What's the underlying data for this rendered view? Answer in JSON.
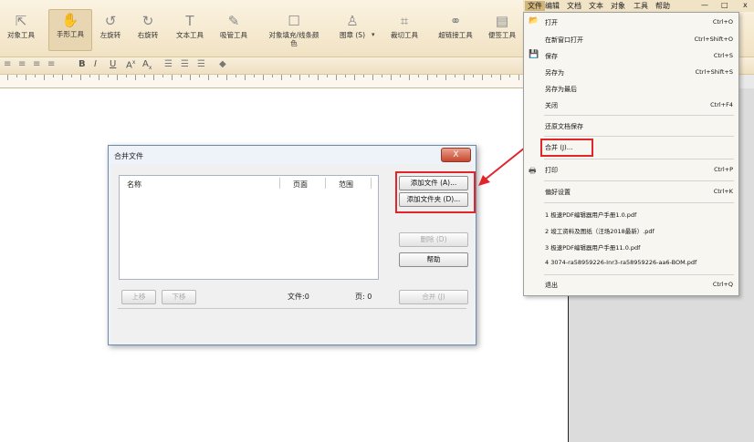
{
  "toolbar": {
    "tools": [
      {
        "label": "对象工具",
        "icon": "cursor-icon"
      },
      {
        "label": "手形工具",
        "icon": "hand-icon"
      },
      {
        "label": "左旋转",
        "icon": "rotate-left-icon"
      },
      {
        "label": "右旋转",
        "icon": "rotate-right-icon"
      },
      {
        "label": "文本工具",
        "icon": "text-icon"
      },
      {
        "label": "吸管工具",
        "icon": "eyedropper-icon"
      },
      {
        "label": "对象填充/线条颜",
        "label2": "色",
        "icon": "fill-icon"
      },
      {
        "label": "图章 (S)",
        "icon": "stamp-icon"
      },
      {
        "label": "裁切工具",
        "icon": "crop-icon"
      },
      {
        "label": "超链接工具",
        "icon": "link-icon"
      },
      {
        "label": "便签工具",
        "icon": "note-icon"
      }
    ]
  },
  "menubar": {
    "items": [
      "文件",
      "编辑",
      "文档",
      "文本",
      "对象",
      "工具",
      "帮助"
    ],
    "minimize": "—",
    "restore": "□",
    "close": "x"
  },
  "file_menu": {
    "items": [
      {
        "label": "打开",
        "shortcut": "Ctrl+O",
        "icon": "folder-open-icon"
      },
      {
        "label": "在新窗口打开",
        "shortcut": "Ctrl+Shift+O"
      },
      {
        "label": "保存",
        "shortcut": "Ctrl+S",
        "icon": "save-icon"
      },
      {
        "label": "另存为",
        "shortcut": "Ctrl+Shift+S"
      },
      {
        "label": "另存为最后",
        "shortcut": ""
      },
      {
        "label": "关闭",
        "shortcut": "Ctrl+F4"
      },
      {
        "label": "还原文档保存",
        "shortcut": ""
      },
      {
        "label": "合并 (J)...",
        "shortcut": ""
      },
      {
        "label": "打印",
        "shortcut": "Ctrl+P",
        "icon": "printer-icon"
      },
      {
        "label": "偏好设置",
        "shortcut": "Ctrl+K"
      },
      {
        "label": "1 极速PDF编辑器用户手册1.0.pdf",
        "shortcut": ""
      },
      {
        "label": "2 竣工资料及图纸（汪场2018最新）.pdf",
        "shortcut": ""
      },
      {
        "label": "3 极速PDF编辑器用户手册11.0.pdf",
        "shortcut": ""
      },
      {
        "label": "4 3074-ra58959226-Inr3-ra58959226-aa6-BOM.pdf",
        "shortcut": ""
      },
      {
        "label": "退出",
        "shortcut": "Ctrl+Q"
      }
    ]
  },
  "dialog": {
    "title": "合并文件",
    "close": "X",
    "columns": [
      "名称",
      "页面",
      "范围"
    ],
    "add_file": "添加文件 (A)...",
    "add_folder": "添加文件夹 (D)...",
    "delete": "删除 (D)",
    "help": "帮助",
    "move_up": "上移",
    "move_down": "下移",
    "files_count": "文件:0",
    "pages_count": "页: 0",
    "merge": "合并 (J)"
  },
  "colors": {
    "highlight": "#e0262b",
    "toolbar": "#f1e2c3"
  }
}
